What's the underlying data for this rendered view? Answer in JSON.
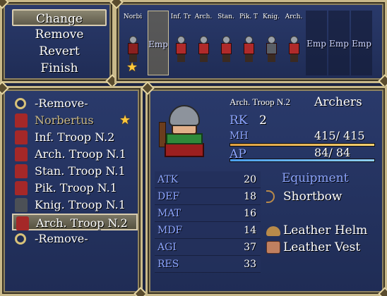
{
  "commands": [
    "Change",
    "Remove",
    "Revert",
    "Finish"
  ],
  "selected_command": 0,
  "formation": [
    {
      "label": "Norbi",
      "empty": false,
      "leader": true,
      "sprite": "gold"
    },
    {
      "label": "Emp",
      "empty": true,
      "current": true
    },
    {
      "label": "Inf. Tr",
      "empty": false,
      "sprite": "red"
    },
    {
      "label": "Arch.",
      "empty": false,
      "sprite": "red"
    },
    {
      "label": "Stan.",
      "empty": false,
      "sprite": "red"
    },
    {
      "label": "Pik. T",
      "empty": false,
      "sprite": "red"
    },
    {
      "label": "Knig.",
      "empty": false,
      "sprite": "dark"
    },
    {
      "label": "Arch.",
      "empty": false,
      "sprite": "red"
    },
    {
      "label": "Emp",
      "empty": true
    },
    {
      "label": "Emp",
      "empty": true
    },
    {
      "label": "Emp",
      "empty": true
    }
  ],
  "roster": [
    {
      "label": "-Remove-",
      "icon": "ring"
    },
    {
      "label": "Norbertus",
      "icon": "mini",
      "gray": true,
      "star": true
    },
    {
      "label": "Inf. Troop N.2",
      "icon": "mini"
    },
    {
      "label": "Arch. Troop N.1",
      "icon": "mini"
    },
    {
      "label": "Stan. Troop N.1",
      "icon": "mini"
    },
    {
      "label": "Pik. Troop N.1",
      "icon": "mini"
    },
    {
      "label": "Knig. Troop N.1",
      "icon": "dark"
    },
    {
      "label": "Arch. Troop N.2",
      "icon": "mini",
      "selected": true
    },
    {
      "label": "-Remove-",
      "icon": "ring"
    }
  ],
  "unit": {
    "name": "Arch. Troop N.2",
    "class": "Archers",
    "rk_label": "RK",
    "rk": "2",
    "mh_label": "MH",
    "mh_text": "415/ 415",
    "mh_fraction": 1.0,
    "ap_label": "AP",
    "ap_text": "84/ 84",
    "ap_fraction": 1.0
  },
  "stats": [
    {
      "k": "ATK",
      "v": "20"
    },
    {
      "k": "DEF",
      "v": "18"
    },
    {
      "k": "MAT",
      "v": "16"
    },
    {
      "k": "MDF",
      "v": "14"
    },
    {
      "k": "AGI",
      "v": "37"
    },
    {
      "k": "RES",
      "v": "33"
    }
  ],
  "equipment_title": "Equipment",
  "equipment": [
    {
      "name": "Shortbow",
      "icon": "bow-icon"
    },
    {
      "name": "",
      "icon": ""
    },
    {
      "name": "Leather Helm",
      "icon": "helm-icon"
    },
    {
      "name": "Leather Vest",
      "icon": "vest-icon"
    }
  ],
  "colors": {
    "frame": "#c9b98a",
    "window": "#24345f",
    "key": "#8ea6ff",
    "star": "#ffc83a"
  }
}
